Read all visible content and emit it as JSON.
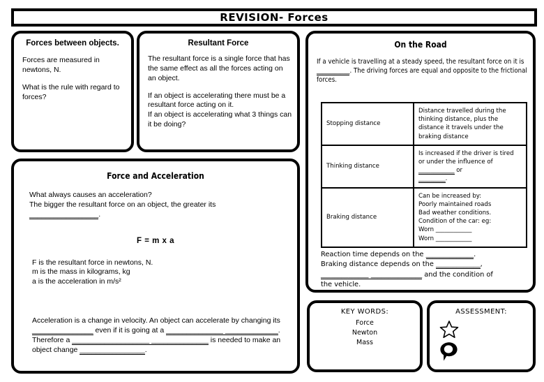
{
  "header": {
    "title": "REVISION- Forces"
  },
  "panels": {
    "forces_between": {
      "title": "Forces between objects.",
      "line1": "Forces are measured in newtons, N.",
      "line2": "What is the rule with regard to forces?"
    },
    "resultant_force": {
      "title": "Resultant Force",
      "para1": "The resultant force is a single force that has the same effect as all the forces acting on an object.",
      "para2_line1": "If an object is accelerating there must be a resultant force acting on it.",
      "para2_line2": "If an object is accelerating what 3 things can it be doing?"
    },
    "on_the_road": {
      "title": "On the Road",
      "intro_a": "If a vehicle is travelling at a steady speed, the resultant force on it is ",
      "intro_blank": "___________",
      "intro_b": ". The driving forces are equal and opposite to the frictional forces.",
      "table": {
        "rows": [
          {
            "term": "Stopping distance",
            "desc": "Distance travelled during the thinking distance, plus the distance it travels under the braking distance"
          },
          {
            "term": "Thinking distance",
            "desc_line1": "Is increased if the driver is tired",
            "desc_line2": "or under the influence of",
            "desc_line3_blank": "____________",
            "desc_line3_word": " or",
            "desc_line4_blank": "_________",
            "desc_line4_end": "."
          },
          {
            "term": "Braking distance",
            "desc_line1": "Can be increased by:",
            "desc_line2": "Poorly maintained roads",
            "desc_line3": "Bad weather conditions.",
            "desc_line4": "Condition of the car: eg:",
            "desc_line5": "Worn ____________",
            "desc_line6": "Worn ____________"
          }
        ]
      },
      "after_line1_a": "Reaction time depends on the ",
      "after_line1_blank": "______________",
      "after_line1_b": ".",
      "after_line2_a": "Braking distance depends on the ",
      "after_line2_blank": "_____________",
      "after_line2_b": ",",
      "after_line3_blank1": "______________",
      "after_line3_blank2": " _______________",
      "after_line3_text": " and the condition of",
      "after_line4": "the vehicle."
    },
    "force_acceleration": {
      "title": "Force and Acceleration",
      "q1": "What always causes an acceleration?",
      "q2": "The bigger the resultant force on an object, the greater its",
      "q3_blank": "_________________",
      "q3_end": ".",
      "formula": "F = m x a",
      "def_f": "F is the resultant force in newtons, N.",
      "def_m": "m is the mass in kilograms, kg",
      "def_a": "a is the acceleration in m/s²",
      "accel_line1": "Acceleration is a change in velocity.  An object can accelerate by changing its",
      "accel_line2_blank": "_______________",
      "accel_line2_mid": " even if it is going at a ",
      "accel_line2_blank2": "______________",
      "accel_line2_blank3": " _____________",
      "accel_line2_end": ".",
      "accel_line3_a": "Therefore a ",
      "accel_line3_blank1": "___________________",
      "accel_line3_blank2": " ______________",
      "accel_line3_b": " is needed to make an",
      "accel_line4_a": "object change ",
      "accel_line4_blank": "________________",
      "accel_line4_b": "."
    },
    "key_words": {
      "title": "KEY WORDS:",
      "words": [
        "Force",
        "Newton",
        "Mass"
      ]
    },
    "assessment": {
      "title": "ASSESSMENT:",
      "icons": [
        "star-icon",
        "speech-bubble-icon"
      ]
    }
  },
  "colors": {
    "ink": "#000000",
    "paper": "#ffffff"
  }
}
